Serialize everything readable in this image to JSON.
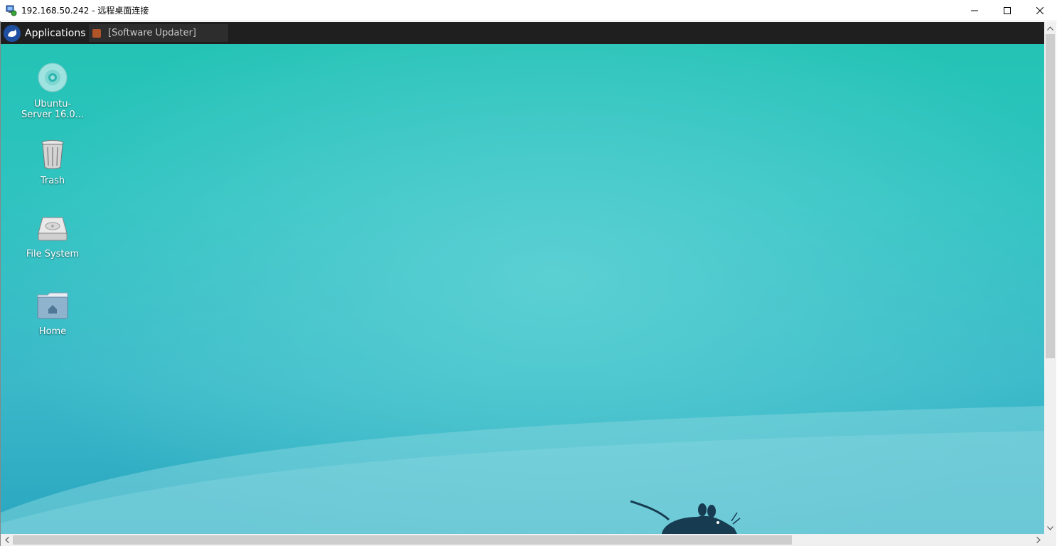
{
  "window": {
    "title": "192.168.50.242 - 远程桌面连接",
    "app_icon": "remote-desktop-icon",
    "controls": [
      "minimize",
      "maximize",
      "close"
    ]
  },
  "panel": {
    "menu_label": "Applications",
    "menu_icon": "xfce-logo-icon",
    "tasks": [
      {
        "label": "[Software Updater]",
        "icon": "software-updater-icon"
      }
    ]
  },
  "desktop": {
    "icons": [
      {
        "label_line1": "Ubuntu-",
        "label_line2": "Server 16.0...",
        "icon": "optical-disc-icon"
      },
      {
        "label": "Trash",
        "icon": "trash-icon"
      },
      {
        "label": "File System",
        "icon": "hard-drive-icon"
      },
      {
        "label": "Home",
        "icon": "home-folder-icon"
      }
    ],
    "wallpaper_colors": {
      "top": "#22c3b4",
      "middle": "#5bd0d3",
      "bottom": "#2aa6c0",
      "mouse": "#173c52"
    }
  },
  "colors": {
    "panel_bg": "#1f1f1f",
    "scrollbar_bg": "#f0f0f0",
    "scrollbar_thumb": "#cdcdcd"
  }
}
